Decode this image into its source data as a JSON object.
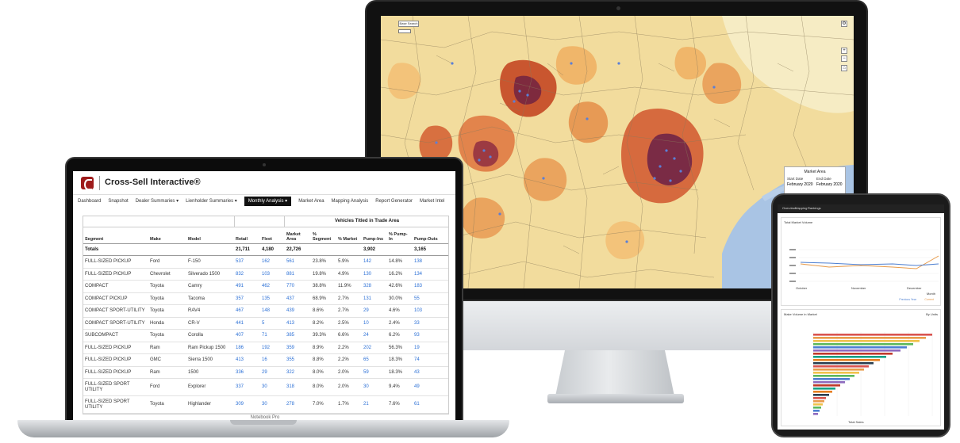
{
  "imac": {
    "map": {
      "search_label": "Base Search",
      "overlay": {
        "title": "Market Area",
        "left_label": "Start Date",
        "left_value": "February 2020",
        "right_label": "End Date",
        "right_value": "February 2020"
      }
    }
  },
  "laptop": {
    "model_label": "Notebook Pro",
    "app": {
      "title": "Cross-Sell Interactive®",
      "nav": [
        "Dashboard",
        "Snapshot",
        "Dealer Summaries ▾",
        "Lienholder Summaries ▾",
        "Monthly Analysis ▾",
        "Market Area",
        "Mapping Analysis",
        "Report Generator",
        "Market Intel"
      ],
      "active_nav": "Monthly Analysis ▾"
    },
    "table": {
      "group_header": "Vehicles Titled in Trade Area",
      "headers": [
        "Segment",
        "Make",
        "Model",
        "Retail",
        "Fleet",
        "Market Area",
        "% Segment",
        "% Market",
        "Pump-Ins",
        "% Pump-In",
        "Pump-Outs"
      ],
      "totals": [
        "Totals",
        "",
        "",
        "21,711",
        "4,180",
        "22,726",
        "",
        "",
        "3,902",
        "",
        "3,165"
      ],
      "rows": [
        [
          "FULL-SIZED PICKUP",
          "Ford",
          "F-150",
          "537",
          "162",
          "561",
          "23.8%",
          "5.9%",
          "142",
          "14.8%",
          "138"
        ],
        [
          "FULL-SIZED PICKUP",
          "Chevrolet",
          "Silverado 1500",
          "832",
          "103",
          "881",
          "19.8%",
          "4.9%",
          "130",
          "16.2%",
          "134"
        ],
        [
          "COMPACT",
          "Toyota",
          "Camry",
          "491",
          "462",
          "770",
          "38.8%",
          "11.9%",
          "328",
          "42.6%",
          "183"
        ],
        [
          "COMPACT PICKUP",
          "Toyota",
          "Tacoma",
          "357",
          "135",
          "437",
          "68.9%",
          "2.7%",
          "131",
          "30.0%",
          "55"
        ],
        [
          "COMPACT SPORT-UTILITY",
          "Toyota",
          "RAV4",
          "467",
          "148",
          "439",
          "8.6%",
          "2.7%",
          "29",
          "4.6%",
          "103"
        ],
        [
          "COMPACT SPORT-UTILITY",
          "Honda",
          "CR-V",
          "441",
          "5",
          "413",
          "8.2%",
          "2.5%",
          "10",
          "2.4%",
          "33"
        ],
        [
          "SUBCOMPACT",
          "Toyota",
          "Corolla",
          "407",
          "71",
          "385",
          "39.3%",
          "6.6%",
          "24",
          "6.2%",
          "93"
        ],
        [
          "FULL-SIZED PICKUP",
          "Ram",
          "Ram Pickup 1500",
          "186",
          "192",
          "359",
          "8.9%",
          "2.2%",
          "202",
          "56.3%",
          "19"
        ],
        [
          "FULL-SIZED PICKUP",
          "GMC",
          "Sierra 1500",
          "413",
          "16",
          "355",
          "8.8%",
          "2.2%",
          "65",
          "18.3%",
          "74"
        ],
        [
          "FULL-SIZED PICKUP",
          "Ram",
          "1500",
          "336",
          "29",
          "322",
          "8.0%",
          "2.0%",
          "59",
          "18.3%",
          "43"
        ],
        [
          "FULL-SIZED SPORT UTILITY",
          "Ford",
          "Explorer",
          "337",
          "30",
          "318",
          "8.0%",
          "2.0%",
          "30",
          "9.4%",
          "49"
        ],
        [
          "FULL-SIZED SPORT UTILITY",
          "Toyota",
          "Highlander",
          "309",
          "30",
          "278",
          "7.0%",
          "1.7%",
          "21",
          "7.6%",
          "61"
        ]
      ]
    }
  },
  "tablet": {
    "nav": [
      "Overview",
      "Mapping",
      "Rankings"
    ],
    "line_card": {
      "title": "Total Market Volume",
      "x_labels": [
        "October",
        "November",
        "December"
      ],
      "x_axis_title": "Month",
      "legend": [
        "Previous Year",
        "Current"
      ]
    },
    "bar_card": {
      "title": "Make Volume in Market",
      "right_label": "By Units",
      "x_axis_title": "Total Sales"
    }
  }
}
